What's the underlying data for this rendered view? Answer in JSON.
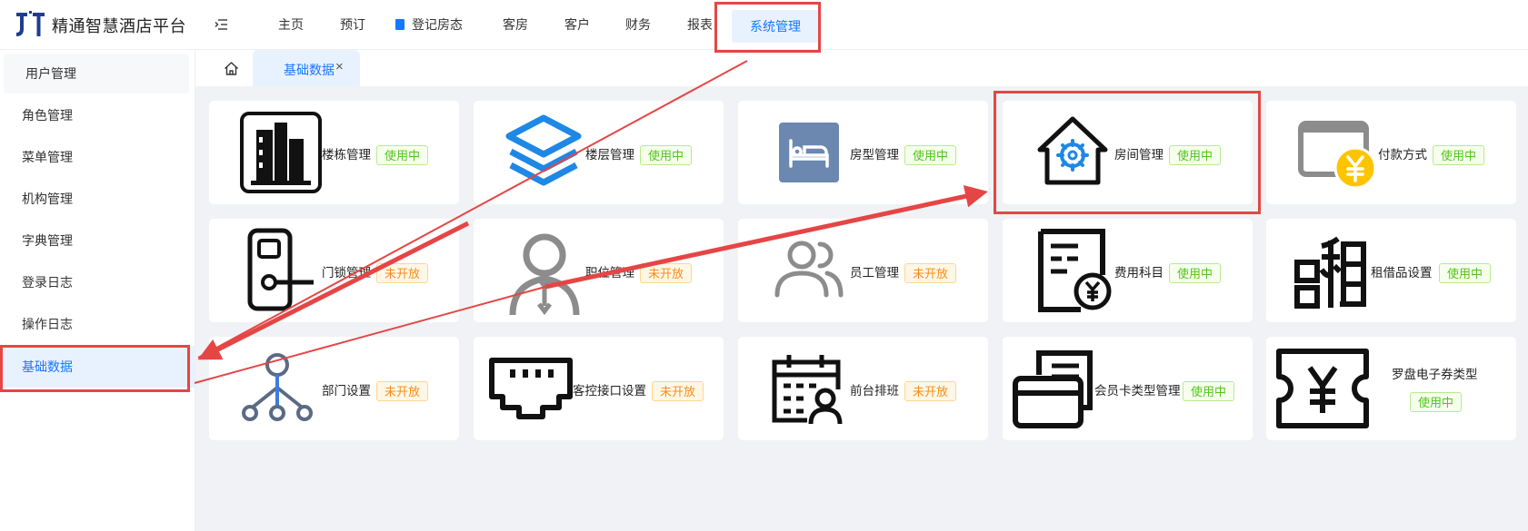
{
  "app": {
    "brand": "精通智慧酒店平台",
    "logo_text": "JT"
  },
  "nav": {
    "items": [
      "主页",
      "预订",
      "登记房态",
      "客房",
      "客户",
      "财务",
      "报表"
    ],
    "active": "系统管理"
  },
  "sidebar": {
    "items": [
      "用户管理",
      "角色管理",
      "菜单管理",
      "机构管理",
      "字典管理",
      "登录日志",
      "操作日志",
      "基础数据"
    ],
    "active_index": 7
  },
  "tabs": [
    {
      "label": "基础数据",
      "close": "×"
    }
  ],
  "cards": [
    {
      "icon": "building-icon",
      "label": "楼栋管理",
      "status": "使用中"
    },
    {
      "icon": "floor-layers-icon",
      "label": "楼层管理",
      "status": "使用中"
    },
    {
      "icon": "bed-icon",
      "label": "房型管理",
      "status": "使用中"
    },
    {
      "icon": "house-gear-icon",
      "label": "房间管理",
      "status": "使用中"
    },
    {
      "icon": "payment-card-icon",
      "label": "付款方式",
      "status": "使用中"
    },
    {
      "icon": "door-lock-icon",
      "label": "门锁管理",
      "status": "未开放"
    },
    {
      "icon": "person-tie-icon",
      "label": "职位管理",
      "status": "未开放"
    },
    {
      "icon": "people-icon",
      "label": "员工管理",
      "status": "未开放"
    },
    {
      "icon": "bill-yen-icon",
      "label": "费用科目",
      "status": "使用中"
    },
    {
      "icon": "rent-icon",
      "label": "租借品设置",
      "status": "使用中"
    },
    {
      "icon": "org-tree-icon",
      "label": "部门设置",
      "status": "未开放"
    },
    {
      "icon": "ethernet-port-icon",
      "label": "客控接口设置",
      "status": "未开放"
    },
    {
      "icon": "calendar-person-icon",
      "label": "前台排班",
      "status": "未开放"
    },
    {
      "icon": "member-card-icon",
      "label": "会员卡类型管理",
      "status": "使用中"
    },
    {
      "icon": "yen-coupon-icon",
      "label": "罗盘电子券类型",
      "status": "使用中"
    }
  ],
  "colors": {
    "accent": "#1677ff",
    "annotation": "#e64545",
    "in_use": "#52c41a",
    "not_open": "#fa8c16"
  }
}
